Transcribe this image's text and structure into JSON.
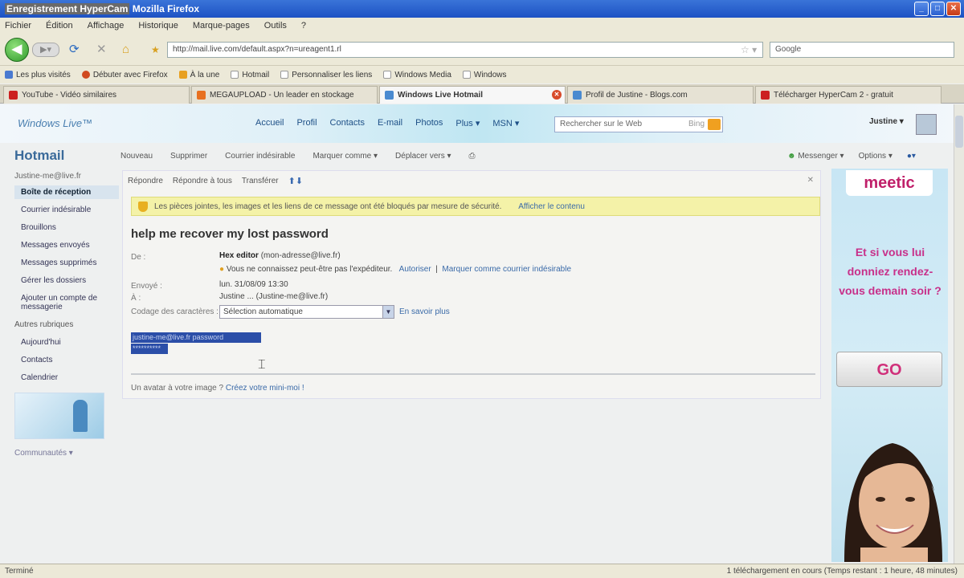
{
  "window": {
    "title_app": "Enregistrement HyperCam",
    "title_suffix": "Mozilla Firefox"
  },
  "menu": [
    "Fichier",
    "Édition",
    "Affichage",
    "Historique",
    "Marque-pages",
    "Outils",
    "?"
  ],
  "nav": {
    "url": "http://mail.live.com/default.aspx?n=ureagent1.rl",
    "search_placeholder": "Google"
  },
  "bookmarks": [
    {
      "label": "Les plus visités",
      "color": "#4a7ad0"
    },
    {
      "label": "Débuter avec Firefox",
      "color": "#d04a20"
    },
    {
      "label": "À la une",
      "color": "#e8a020"
    },
    {
      "label": "Hotmail",
      "color": "#ffffff"
    },
    {
      "label": "Personnaliser les liens",
      "color": "#ffffff"
    },
    {
      "label": "Windows Media",
      "color": "#ffffff"
    },
    {
      "label": "Windows",
      "color": "#ffffff"
    }
  ],
  "tabs": [
    {
      "label": "YouTube - Vidéo similaires",
      "color": "#cc2020"
    },
    {
      "label": "MEGAUPLOAD - Un leader en stockage",
      "color": "#e87020"
    },
    {
      "label": "Windows Live Hotmail",
      "color": "#4a8ad0"
    },
    {
      "label": "Profil de Justine - Blogs.com",
      "color": "#4a8ad0"
    },
    {
      "label": "Télécharger HyperCam 2 - gratuit",
      "color": "#cc2020"
    }
  ],
  "live": {
    "logo": "Windows Live™",
    "nav": [
      "Accueil",
      "Profil",
      "Contacts",
      "E-mail",
      "Photos",
      "Plus ▾",
      "MSN ▾"
    ],
    "search_placeholder": "Rechercher sur le Web",
    "search_button": "Bing",
    "user_name": "Justine ▾"
  },
  "hotmail": {
    "title": "Hotmail",
    "toolbar": [
      "Nouveau",
      "Supprimer",
      "Courrier indésirable",
      "Marquer comme ▾",
      "Déplacer vers ▾"
    ],
    "right_tools": [
      "Messenger ▾",
      "Options ▾"
    ]
  },
  "sidebar": {
    "account": "Justine-me@live.fr",
    "folders": [
      "Boîte de réception",
      "Courrier indésirable",
      "Brouillons",
      "Messages envoyés",
      "Messages supprimés",
      "Gérer les dossiers",
      "Ajouter un compte de messagerie"
    ],
    "other_title": "Autres rubriques",
    "other": [
      "Aujourd'hui",
      "Contacts",
      "Calendrier"
    ],
    "footer": "Communautés ▾"
  },
  "message": {
    "actions": [
      "Répondre",
      "Répondre à tous",
      "Transférer"
    ],
    "security_text": "Les pièces jointes, les images et les liens de ce message ont été bloqués par mesure de sécurité.",
    "security_link": "Afficher le contenu",
    "subject": "help me recover my lost password",
    "from_label": "De :",
    "from_name": "Hex editor",
    "from_email": "(mon-adresse@live.fr)",
    "trust_text": "Vous ne connaissez peut-être pas l'expéditeur.",
    "trust_link1": "Autoriser",
    "trust_link2": "Marquer comme courrier indésirable",
    "sent_label": "Envoyé :",
    "sent_value": "lun. 31/08/09 13:30",
    "to_label": "À :",
    "to_value": "Justine ... (Justine-me@live.fr)",
    "encoding_label": "Codage des caractères :",
    "encoding_value": "Sélection automatique",
    "encoding_link": "En savoir plus",
    "body_line1": "justine-me@live.fr password",
    "body_line2": "**********",
    "footer_text": "Un avatar à votre image ?",
    "footer_link": "Créez votre mini-moi !"
  },
  "ad": {
    "brand": "meetic",
    "text": "Et si vous lui donniez rendez-vous demain soir ?",
    "cta": "GO",
    "accent": "#c8308a"
  },
  "status": {
    "left": "Terminé",
    "right": "1 téléchargement en cours (Temps restant : 1 heure, 48 minutes)"
  }
}
